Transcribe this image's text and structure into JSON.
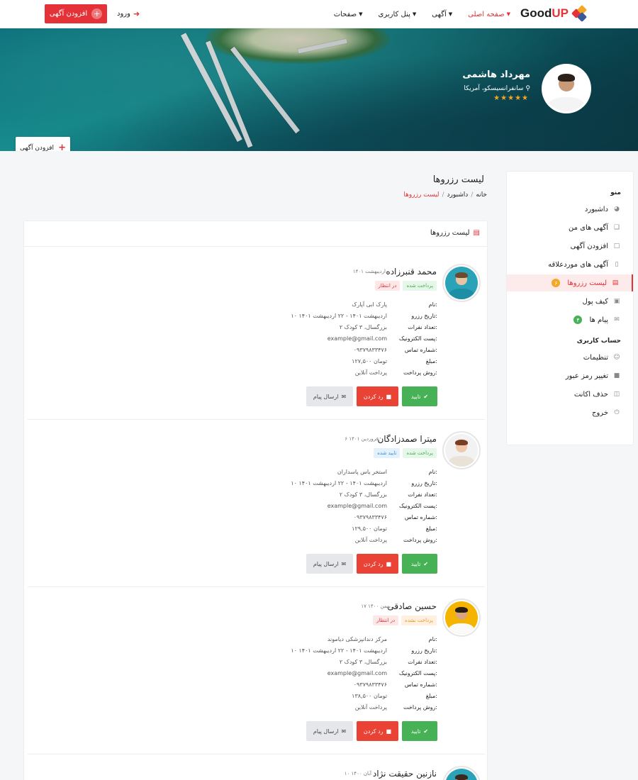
{
  "header": {
    "logo_text": "Good",
    "logo_accent": "UP",
    "nav": [
      {
        "label": "صفحه اصلی",
        "active": true
      },
      {
        "label": "آگهی",
        "active": false
      },
      {
        "label": "پنل کاربری",
        "active": false
      },
      {
        "label": "صفحات",
        "active": false
      }
    ],
    "login_label": "ورود",
    "add_ad_label": "افزودن آگهی"
  },
  "profile": {
    "name": "مهرداد هاشمی",
    "location": "سانفرانسیسکو، آمریکا",
    "stars": "★★★★★",
    "rating": 5,
    "add_ad_label": "افزودن آگهی"
  },
  "sidebar": {
    "menu_title": "منو",
    "items": [
      {
        "label": "داشبورد",
        "icon": "dashboard-icon"
      },
      {
        "label": "آگهی های من",
        "icon": "ads-icon"
      },
      {
        "label": "افزودن آگهی",
        "icon": "add-file-icon"
      },
      {
        "label": "آگهی های موردعلاقه",
        "icon": "bookmark-icon"
      },
      {
        "label": "لیست رزروها",
        "icon": "basket-icon",
        "active": true,
        "badge": "۶"
      },
      {
        "label": "کیف پول",
        "icon": "wallet-icon"
      },
      {
        "label": "پیام ها",
        "icon": "mail-icon",
        "badge": "۴"
      }
    ],
    "account_title": "حساب کاربری",
    "account_items": [
      {
        "label": "تنظیمات",
        "icon": "user-icon"
      },
      {
        "label": "تغییر رمز عبور",
        "icon": "lock-icon"
      },
      {
        "label": "حذف اکانت",
        "icon": "trash-icon"
      },
      {
        "label": "خروج",
        "icon": "power-icon"
      }
    ]
  },
  "page": {
    "title": "لیست رزروها",
    "breadcrumb": [
      "خانه",
      "داشبورد",
      "لیست رزروها"
    ]
  },
  "panel": {
    "title": "لیست رزروها",
    "field_labels": {
      "name": "نام:",
      "date": "تاریخ رزرو:",
      "count": "تعداد نفرات:",
      "email": "پست الکترونیک:",
      "phone": "شماره تماس:",
      "amount": "مبلغ:",
      "method": "روش پرداخت:"
    },
    "buttons": {
      "approve": "تایید",
      "reject": "رد کردن",
      "message": "ارسال پیام"
    }
  },
  "bookings": [
    {
      "customer": "محمد قنبرزاده",
      "submitted": "اردیبهشت ۱۴۰۱",
      "tags": [
        {
          "text": "پرداخت شده",
          "color": "green"
        },
        {
          "text": "در انتظار",
          "color": "red"
        }
      ],
      "name": "پارک ابی آپارک",
      "date": "۱۰ اردیبهشت ۱۴۰۱ - ۲۲ اردیبهشت ۱۴۰۱",
      "count": "۲ بزرگسال، ۳ کودک",
      "email": "example@gmail.com",
      "phone": "۰۹۳۷۹۸۳۳۴۷۶",
      "amount": "۱۲۷,۵۰۰ تومان",
      "method": "پرداخت آنلاین"
    },
    {
      "customer": "میترا صمدزادگان",
      "submitted": "۶ فروردین ۱۴۰۱",
      "tags": [
        {
          "text": "پرداخت شده",
          "color": "green"
        },
        {
          "text": "تایید شده",
          "color": "blue"
        }
      ],
      "name": "استخر یاس پاسداران",
      "date": "۱۰ اردیبهشت ۱۴۰۱ - ۲۲ اردیبهشت ۱۴۰۱",
      "count": "۲ بزرگسال، ۳ کودک",
      "email": "example@gmail.com",
      "phone": "۰۹۳۷۹۸۳۳۴۷۶",
      "amount": "۱۲۹,۵۰۰ تومان",
      "method": "پرداخت آنلاین"
    },
    {
      "customer": "حسین صادقی",
      "submitted": "۱۷ بهمن ۱۴۰۰",
      "tags": [
        {
          "text": "پرداخت نشده",
          "color": "orange"
        },
        {
          "text": "در انتظار",
          "color": "red"
        }
      ],
      "name": "مرکز دندانپزشکی دیاموند",
      "date": "۱۰ اردیبهشت ۱۴۰۱ - ۲۲ اردیبهشت ۱۴۰۱",
      "count": "۲ بزرگسال، ۳ کودک",
      "email": "example@gmail.com",
      "phone": "۰۹۳۷۹۸۳۳۴۷۶",
      "amount": "۱۳۸,۵۰۰ تومان",
      "method": "پرداخت آنلاین"
    },
    {
      "customer": "نازنین حقیقت نژاد",
      "submitted": "۱۰ آبان ۱۴۰۰",
      "tags": [],
      "name": "",
      "date": "",
      "count": "",
      "email": "",
      "phone": "",
      "amount": "",
      "method": ""
    }
  ],
  "colors": {
    "accent": "#e53238",
    "green": "#47b255",
    "red_button": "#ea4335",
    "gray_button": "#e5e7eb",
    "star": "#f5a623"
  }
}
